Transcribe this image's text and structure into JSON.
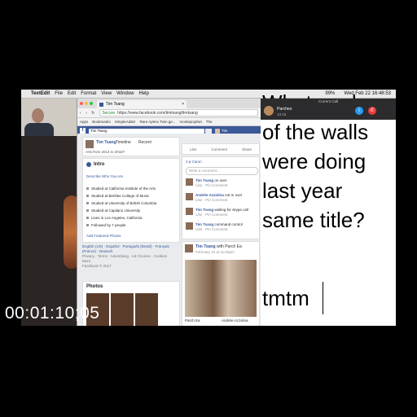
{
  "menubar": {
    "app": "TextEdit",
    "items": [
      "File",
      "Edit",
      "Format",
      "View",
      "Window",
      "Help"
    ],
    "battery": "99%",
    "clock": "Wed Feb 22 16:48:53"
  },
  "browser": {
    "tab_title": "Tim Tsang",
    "secure_label": "Secure",
    "url": "https://www.facebook.com/timtsang/timtsang",
    "bookmarks": [
      "Apps",
      "Bookmarks",
      "SimpleAdder",
      "Rare Aphex Twin ge...",
      "monkiprophet",
      "The"
    ]
  },
  "facebook": {
    "search_value": "Tim Tsang",
    "user_name": "Tim",
    "profile": {
      "name": "Tim Tsang",
      "timeline_label": "Timeline",
      "recent_label": "Recent",
      "arts_line": "Arts from 2014 to 2018?"
    },
    "intro": {
      "title": "Intro",
      "describe": "Describe Who You Are",
      "items": [
        "Studied at California Institute of the Arts",
        "Studied at Berklee College of Music",
        "Studied at University of British Columbia",
        "Studied at Capilano University",
        "Lives in Los Angeles, California",
        "Followed by 7 people"
      ],
      "featured": "Add Featured Photos"
    },
    "languages": {
      "line1": "English (US) · Español · Português (Brasil) · Français (France) · Deutsch",
      "line2": "Privacy · Terms · Advertising · Ad Choices · Cookies · More",
      "line3": "Facebook © 2017"
    },
    "photos_title": "Photos",
    "actions": [
      "Like",
      "Comment",
      "Share"
    ],
    "comments": {
      "top_name": "J-p Caron",
      "placeholder": "Write a comment...",
      "list": [
        {
          "name": "Tim Tsang",
          "text": "on over",
          "meta": "Like · Pin Comment"
        },
        {
          "name": "Andrée Azzolina",
          "text": "not m over",
          "meta": "Like · Pin Comment"
        },
        {
          "name": "Tim Tsang",
          "text": "waiting for skype call",
          "meta": "Like · Pin Comment"
        },
        {
          "name": "Tim Tsang",
          "text": "command control",
          "meta": "Like · Pin Comment"
        }
      ]
    },
    "post": {
      "author": "Tim Tsang",
      "with_text": "with Parch Ea",
      "date": "February 20 at 11:05pm",
      "caption_left": "Parch Ea",
      "caption_right": "Andrée Azzolina"
    }
  },
  "call": {
    "title": "Current Call",
    "name": "Parches",
    "time": "13:15",
    "info_glyph": "i",
    "end_glyph": "✆"
  },
  "textedit": {
    "lines": [
      "What each",
      "of the walls",
      "were doing",
      "last year",
      "same title?",
      "",
      "tmtm"
    ]
  },
  "timecode": "00:01:10;05"
}
